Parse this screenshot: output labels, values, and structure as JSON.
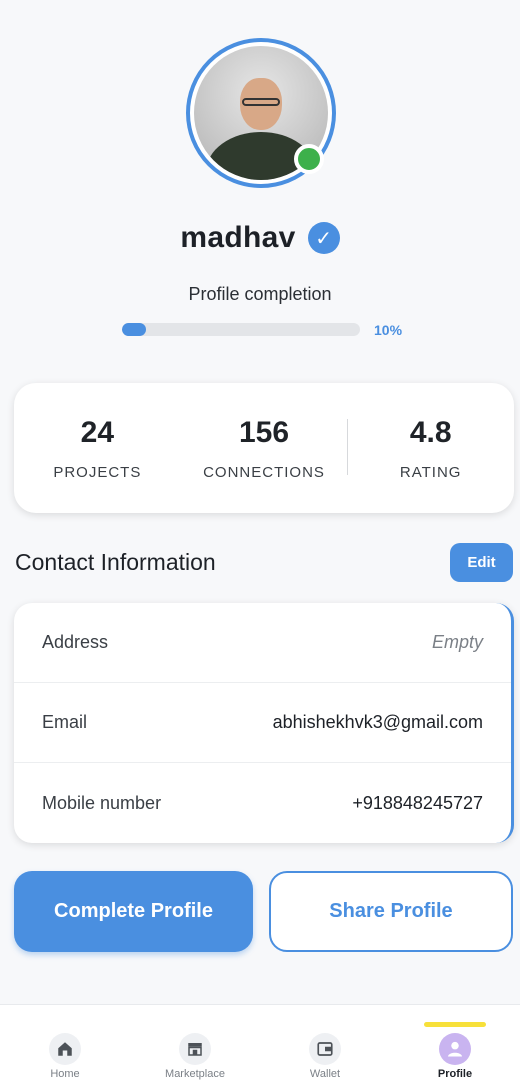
{
  "profile": {
    "name": "madhav",
    "verified_glyph": "✓",
    "completion_label": "Profile completion",
    "completion_percent": 10,
    "completion_text": "10%"
  },
  "stats": [
    {
      "value": "24",
      "label": "PROJECTS"
    },
    {
      "value": "156",
      "label": "CONNECTIONS"
    },
    {
      "value": "4.8",
      "label": "RATING"
    }
  ],
  "contact": {
    "title": "Contact Information",
    "edit_label": "Edit",
    "rows": [
      {
        "label": "Address",
        "value": "Empty"
      },
      {
        "label": "Email",
        "value": "abhishekhvk3@gmail.com"
      },
      {
        "label": "Mobile number",
        "value": "+918848245727"
      }
    ]
  },
  "actions": {
    "complete_label": "Complete Profile",
    "share_label": "Share Profile"
  },
  "nav": {
    "items": [
      {
        "label": "Home",
        "icon": "home-icon"
      },
      {
        "label": "Marketplace",
        "icon": "store-icon"
      },
      {
        "label": "Wallet",
        "icon": "wallet-icon"
      },
      {
        "label": "Profile",
        "icon": "profile-icon"
      }
    ],
    "active_index": 3
  },
  "colors": {
    "accent": "#4a8fe0",
    "online": "#3db04b",
    "active_indicator": "#f7e03a"
  }
}
